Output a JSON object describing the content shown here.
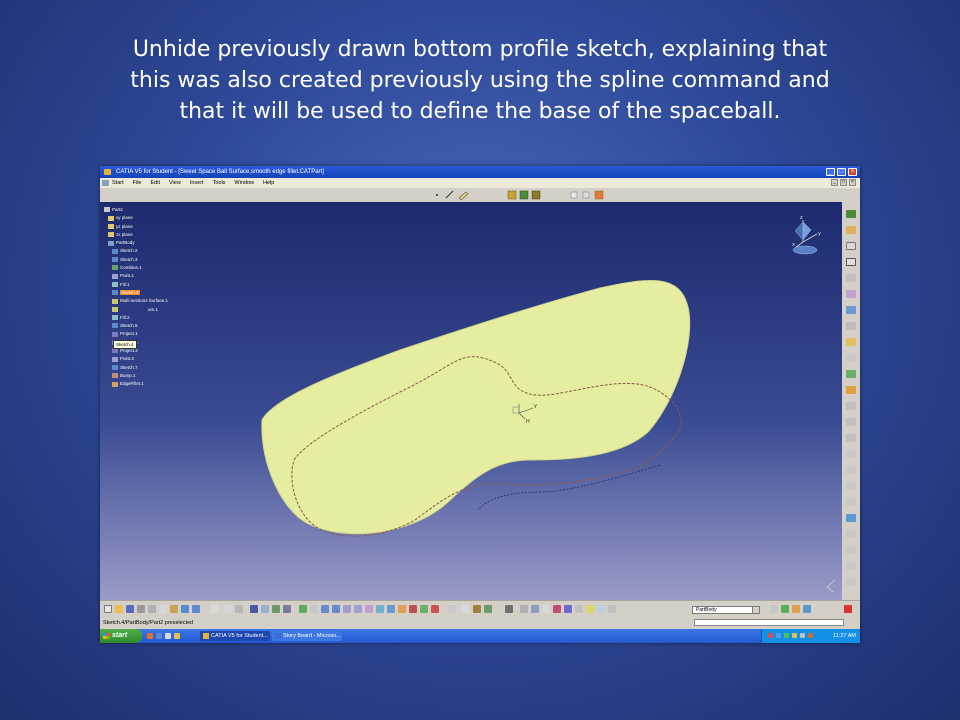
{
  "caption": {
    "line1": "Unhide previously drawn bottom profile sketch, explaining that",
    "line2": "this was also created previously using the spline command and",
    "line3": "that it will be used to define the base of the spaceball."
  },
  "window": {
    "title": "CATIA V5 for Student - [Sweet Space Ball Surface,smooth edge fillet.CATPart]"
  },
  "menu": [
    "Start",
    "File",
    "Edit",
    "View",
    "Insert",
    "Tools",
    "Window",
    "Help"
  ],
  "tree": [
    {
      "label": "Part2",
      "icon": "part-icon"
    },
    {
      "label": "xy plane",
      "icon": "plane-icon"
    },
    {
      "label": "yz plane",
      "icon": "plane-icon"
    },
    {
      "label": "zx plane",
      "icon": "plane-icon"
    },
    {
      "label": "PartBody",
      "icon": "body-icon"
    },
    {
      "label": "Sketch.2",
      "icon": "sketch-icon"
    },
    {
      "label": "Sketch.3",
      "icon": "sketch-icon"
    },
    {
      "label": "Combine.1",
      "icon": "curve-icon"
    },
    {
      "label": "Point.1",
      "icon": "point-icon"
    },
    {
      "label": "Fill.1",
      "icon": "fill-icon"
    },
    {
      "label": "Sketch.4",
      "icon": "sketch-icon",
      "highlight": true
    },
    {
      "label": "Multi-sections Surface.1",
      "icon": "surface-icon"
    },
    {
      "label": "Sketch.4",
      "icon": "surface-icon",
      "partial": "um.1"
    },
    {
      "label": "Fill.2",
      "icon": "fill-icon"
    },
    {
      "label": "Sketch.5",
      "icon": "sketch-icon"
    },
    {
      "label": "Project.1",
      "icon": "project-icon"
    },
    {
      "label": "Sketch.6",
      "icon": "sketch-icon"
    },
    {
      "label": "Project.2",
      "icon": "project-icon"
    },
    {
      "label": "Point.2",
      "icon": "point-icon"
    },
    {
      "label": "Sketch.7",
      "icon": "sketch-icon"
    },
    {
      "label": "Bump.1",
      "icon": "bump-icon"
    },
    {
      "label": "EdgeFillet.1",
      "icon": "fillet-icon"
    }
  ],
  "tooltip": "Sketch.4",
  "compass_labels": {
    "z": "z",
    "y": "y",
    "x": "x"
  },
  "part_selector": "PartBody",
  "status": "Sketch.4/PartBody/Part2 preselected",
  "taskbar": {
    "start": "start",
    "tasks": [
      "CATIA V5 for Student...",
      "Story Board - Microso..."
    ],
    "clock": "11:27 AM"
  },
  "colors": {
    "surface_fill": "#e6eda0",
    "slide_bg": "#3a56a8",
    "highlight": "#f08a2a",
    "sketch_curve": "#8a5a4a"
  }
}
